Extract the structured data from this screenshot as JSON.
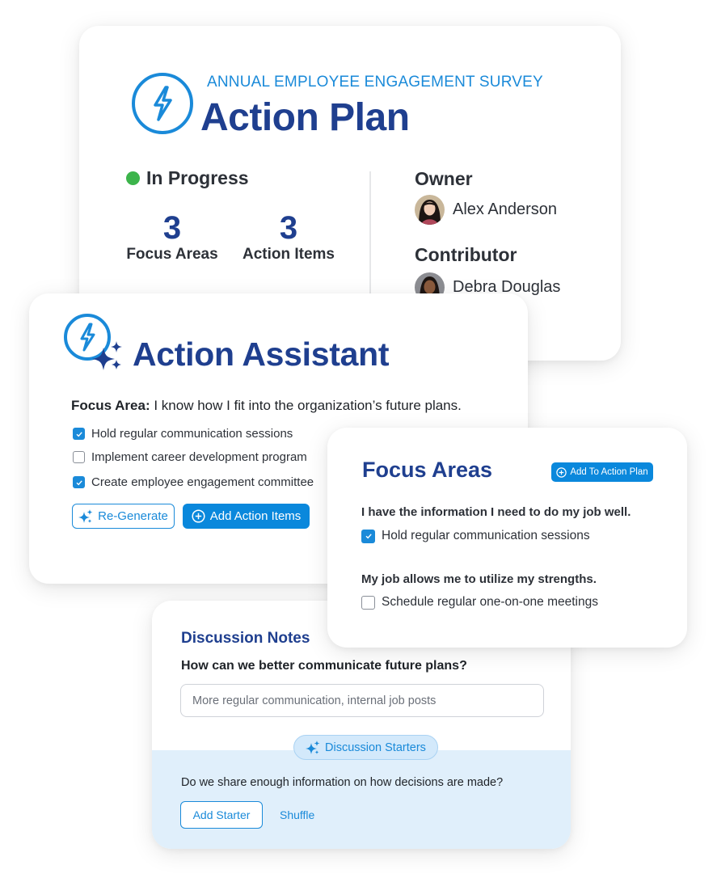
{
  "action_plan": {
    "subtitle": "ANNUAL EMPLOYEE ENGAGEMENT SURVEY",
    "title": "Action Plan",
    "logo_icon": "lightning-bolt-circle-icon",
    "status": {
      "label": "In Progress",
      "color": "#3cb44b"
    },
    "stats": [
      {
        "value": "3",
        "label": "Focus Areas"
      },
      {
        "value": "3",
        "label": "Action Items"
      }
    ],
    "owner": {
      "heading": "Owner",
      "name": "Alex Anderson"
    },
    "contributor": {
      "heading": "Contributor",
      "name": "Debra Douglas"
    }
  },
  "action_assistant": {
    "title": "Action Assistant",
    "logo_icon": "lightning-bolt-sparkle-icon",
    "focus_area_label": "Focus Area:",
    "focus_area_text": " I know how I fit into the organization’s future plans.",
    "items": [
      {
        "label": "Hold regular communication sessions",
        "checked": true
      },
      {
        "label": "Implement career development program",
        "checked": false
      },
      {
        "label": "Create employee engagement committee",
        "checked": true
      }
    ],
    "regenerate_label": "Re-Generate",
    "add_items_label": "Add Action Items"
  },
  "focus_areas": {
    "title": "Focus Areas",
    "add_button_label": "Add To Action Plan",
    "groups": [
      {
        "question": "I have the information I need to do my job well.",
        "item": {
          "label": "Hold regular communication sessions",
          "checked": true
        }
      },
      {
        "question": "My job allows me to utilize my strengths.",
        "item": {
          "label": "Schedule regular one-on-one meetings",
          "checked": false
        }
      }
    ]
  },
  "discussion_notes": {
    "title": "Discussion Notes",
    "question": "How can we better communicate future plans?",
    "input_value": "More regular communication, internal job posts",
    "starters_label": "Discussion Starters",
    "starter_question": "Do we share enough information on how decisions are made?",
    "add_starter_label": "Add Starter",
    "shuffle_label": "Shuffle"
  },
  "colors": {
    "brand_dark": "#1f3f8f",
    "accent": "#1a8ad9",
    "button": "#0a88dc",
    "starter_bg": "#e0effb"
  }
}
